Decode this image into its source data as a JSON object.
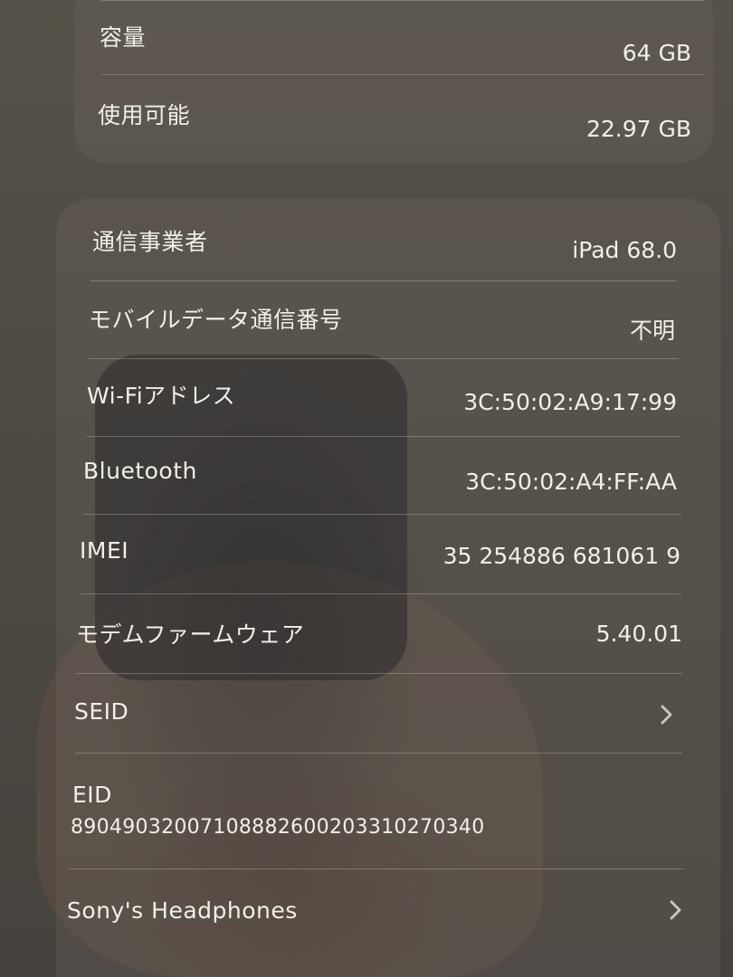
{
  "storage": {
    "capacity_label": "容量",
    "capacity_value": "64 GB",
    "available_label": "使用可能",
    "available_value": "22.97 GB"
  },
  "network": {
    "carrier_label": "通信事業者",
    "carrier_value": "iPad 68.0",
    "mobile_number_label": "モバイルデータ通信番号",
    "mobile_number_value": "不明",
    "wifi_label": "Wi-Fiアドレス",
    "wifi_value": "3C:50:02:A9:17:99",
    "bluetooth_label": "Bluetooth",
    "bluetooth_value": "3C:50:02:A4:FF:AA",
    "imei_label": "IMEI",
    "imei_value": "35 254886 681061 9",
    "modem_label": "モデムファームウェア",
    "modem_value": "5.40.01",
    "seid_label": "SEID",
    "eid_label": "EID",
    "eid_value": "89049032007108882600203310270340",
    "headphones_label": "Sony's Headphones"
  },
  "icons": {
    "seid_chevron": "chevron-right-icon",
    "headphones_chevron": "chevron-right-icon"
  }
}
